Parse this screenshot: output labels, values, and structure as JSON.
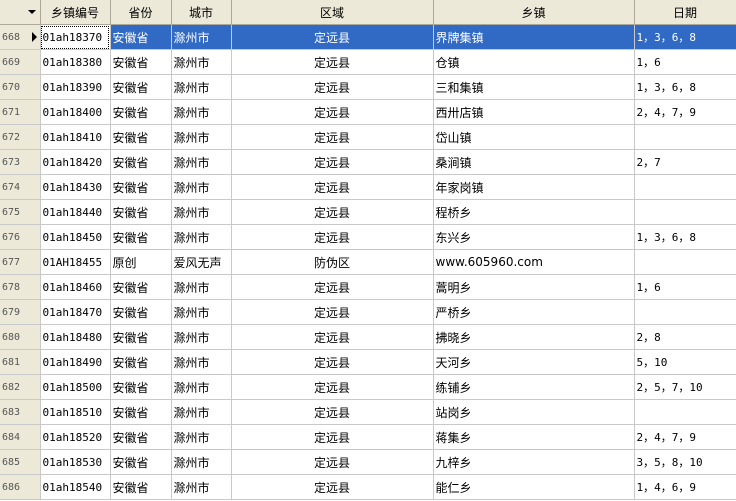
{
  "columns": {
    "code": "乡镇编号",
    "province": "省份",
    "city": "城市",
    "district": "区域",
    "town": "乡镇",
    "dates": "日期"
  },
  "rows": [
    {
      "num": "668",
      "code": "01ah18370",
      "province": "安徽省",
      "city": "滁州市",
      "district": "定远县",
      "town": "界牌集镇",
      "dates": "1，3，6，8",
      "selected": true
    },
    {
      "num": "669",
      "code": "01ah18380",
      "province": "安徽省",
      "city": "滁州市",
      "district": "定远县",
      "town": "仓镇",
      "dates": "1，6"
    },
    {
      "num": "670",
      "code": "01ah18390",
      "province": "安徽省",
      "city": "滁州市",
      "district": "定远县",
      "town": "三和集镇",
      "dates": "1，3，6，8"
    },
    {
      "num": "671",
      "code": "01ah18400",
      "province": "安徽省",
      "city": "滁州市",
      "district": "定远县",
      "town": "西卅店镇",
      "dates": "2，4，7，9"
    },
    {
      "num": "672",
      "code": "01ah18410",
      "province": "安徽省",
      "city": "滁州市",
      "district": "定远县",
      "town": "岱山镇",
      "dates": ""
    },
    {
      "num": "673",
      "code": "01ah18420",
      "province": "安徽省",
      "city": "滁州市",
      "district": "定远县",
      "town": "桑涧镇",
      "dates": "2，7"
    },
    {
      "num": "674",
      "code": "01ah18430",
      "province": "安徽省",
      "city": "滁州市",
      "district": "定远县",
      "town": "年家岗镇",
      "dates": ""
    },
    {
      "num": "675",
      "code": "01ah18440",
      "province": "安徽省",
      "city": "滁州市",
      "district": "定远县",
      "town": "程桥乡",
      "dates": ""
    },
    {
      "num": "676",
      "code": "01ah18450",
      "province": "安徽省",
      "city": "滁州市",
      "district": "定远县",
      "town": "东兴乡",
      "dates": "1，3，6，8"
    },
    {
      "num": "677",
      "code": "01AH18455",
      "province": "原创",
      "city": "爱风无声",
      "district": "防伪区",
      "town": "www.605960.com",
      "dates": ""
    },
    {
      "num": "678",
      "code": "01ah18460",
      "province": "安徽省",
      "city": "滁州市",
      "district": "定远县",
      "town": "蒿明乡",
      "dates": "1，6"
    },
    {
      "num": "679",
      "code": "01ah18470",
      "province": "安徽省",
      "city": "滁州市",
      "district": "定远县",
      "town": "严桥乡",
      "dates": ""
    },
    {
      "num": "680",
      "code": "01ah18480",
      "province": "安徽省",
      "city": "滁州市",
      "district": "定远县",
      "town": "拂晓乡",
      "dates": "2，8"
    },
    {
      "num": "681",
      "code": "01ah18490",
      "province": "安徽省",
      "city": "滁州市",
      "district": "定远县",
      "town": "天河乡",
      "dates": "5，10"
    },
    {
      "num": "682",
      "code": "01ah18500",
      "province": "安徽省",
      "city": "滁州市",
      "district": "定远县",
      "town": "练铺乡",
      "dates": "2，5，7，10"
    },
    {
      "num": "683",
      "code": "01ah18510",
      "province": "安徽省",
      "city": "滁州市",
      "district": "定远县",
      "town": "站岗乡",
      "dates": ""
    },
    {
      "num": "684",
      "code": "01ah18520",
      "province": "安徽省",
      "city": "滁州市",
      "district": "定远县",
      "town": "蒋集乡",
      "dates": "2，4，7，9"
    },
    {
      "num": "685",
      "code": "01ah18530",
      "province": "安徽省",
      "city": "滁州市",
      "district": "定远县",
      "town": "九梓乡",
      "dates": "3，5，8，10"
    },
    {
      "num": "686",
      "code": "01ah18540",
      "province": "安徽省",
      "city": "滁州市",
      "district": "定远县",
      "town": "能仁乡",
      "dates": "1，4，6，9"
    }
  ]
}
